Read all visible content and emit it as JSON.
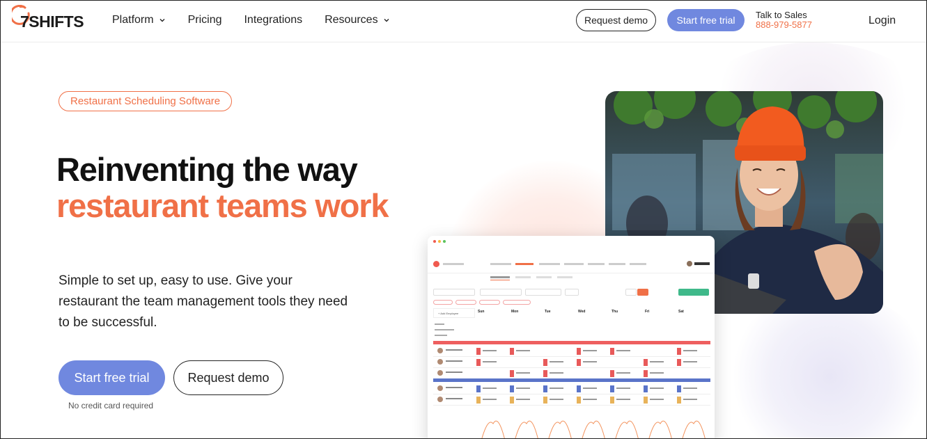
{
  "header": {
    "logo_text": "7SHIFTS",
    "nav": [
      {
        "label": "Platform",
        "has_dropdown": true
      },
      {
        "label": "Pricing",
        "has_dropdown": false
      },
      {
        "label": "Integrations",
        "has_dropdown": false
      },
      {
        "label": "Resources",
        "has_dropdown": true
      }
    ],
    "request_demo": "Request demo",
    "start_trial": "Start free trial",
    "sales_label": "Talk to Sales",
    "sales_phone": "888-979-5877",
    "login": "Login"
  },
  "hero": {
    "badge": "Restaurant Scheduling Software",
    "title_line1": "Reinventing the way",
    "title_line2": "restaurant teams work",
    "subtitle": "Simple to set up, easy to use. Give your restaurant the team management tools they need to be successful.",
    "cta_primary": "Start free trial",
    "cta_secondary": "Request demo",
    "note": "No credit card required"
  },
  "app_preview": {
    "days": [
      "Sun",
      "Mon",
      "Tue",
      "Wed",
      "Thu",
      "Fri",
      "Sat"
    ]
  },
  "colors": {
    "accent": "#f07047",
    "primary": "#7088df",
    "text": "#1b1b1b"
  }
}
